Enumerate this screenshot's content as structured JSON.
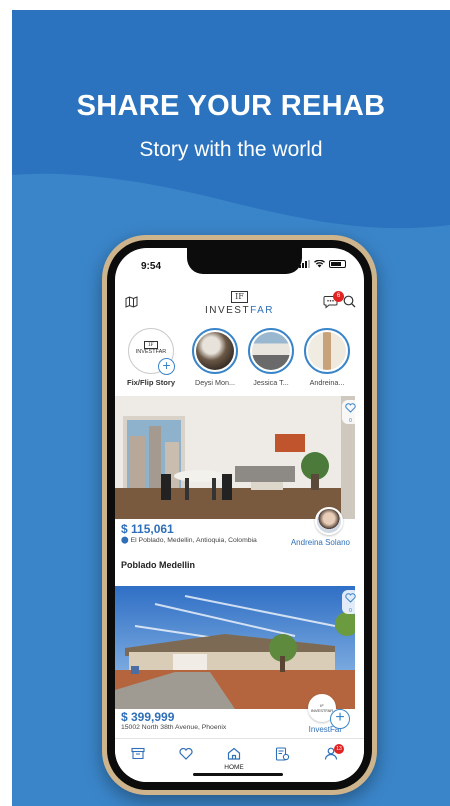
{
  "promo": {
    "headline": "SHARE YOUR REHAB",
    "subheadline": "Story with the world",
    "background_color": "#3a85c9"
  },
  "status_bar": {
    "time": "9:54",
    "icons": [
      "cellular-icon",
      "wifi-icon",
      "battery-icon"
    ]
  },
  "header": {
    "logo_mark": "IF",
    "logo_word_prefix": "INVEST",
    "logo_word_suffix": "FAR",
    "chat_badge": "6",
    "icons": [
      "map-icon",
      "chat-icon",
      "search-icon"
    ]
  },
  "stories": [
    {
      "label": "Fix/Flip Story",
      "logo_mark": "IF",
      "logo_word": "INVESTFAR"
    },
    {
      "label": "Deysi Mon..."
    },
    {
      "label": "Jessica T..."
    },
    {
      "label": "Andreina..."
    }
  ],
  "listings": [
    {
      "price": "$ 115,061",
      "address": "El Poblado, Medellin, Antioquia, Colombia",
      "title": "Poblado Medellin",
      "owner": "Andreina Solano",
      "likes": "0"
    },
    {
      "price": "$ 399,999",
      "address": "15002 North 38th Avenue, Phoenix",
      "owner": "InvestFar",
      "likes": "0",
      "avatar_logo": "IF",
      "avatar_word": "INVESTFAR"
    }
  ],
  "tabbar": {
    "active": "HOME",
    "home_label": "HOME",
    "profile_badge": "13",
    "tabs": [
      "archive-icon",
      "heart-icon",
      "home-icon",
      "document-settings-icon",
      "profile-icon"
    ]
  },
  "colors": {
    "accent": "#2e6fb8",
    "badge": "#e02424"
  }
}
